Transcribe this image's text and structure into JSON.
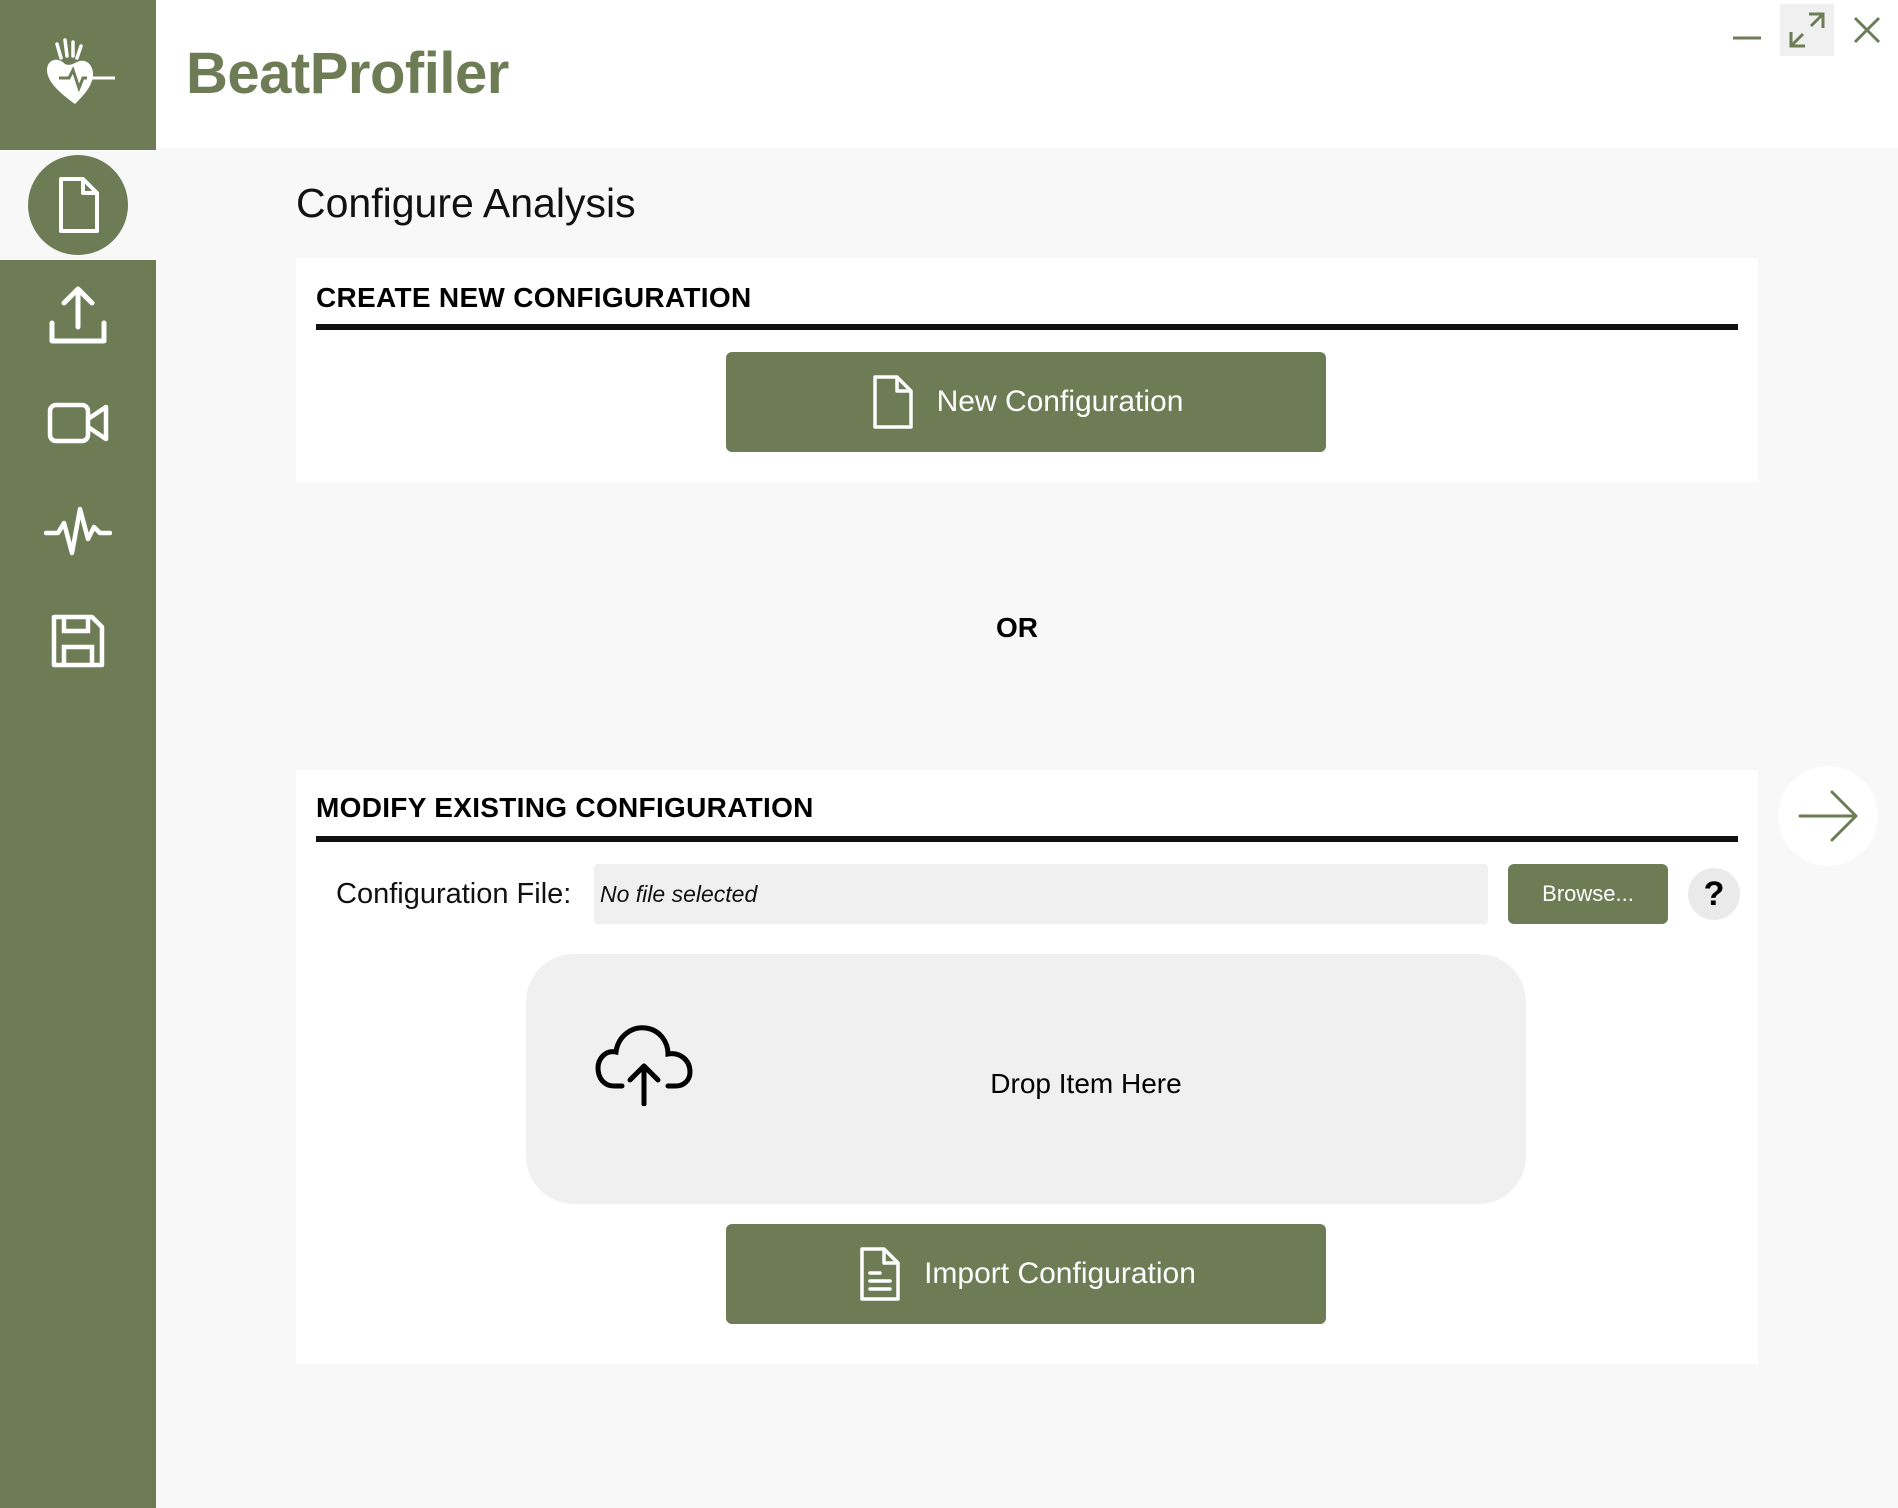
{
  "app": {
    "title": "BeatProfiler"
  },
  "window_controls": {
    "minimize": "minimize-icon",
    "maximize": "maximize-icon",
    "close": "close-icon"
  },
  "sidebar": {
    "items": [
      {
        "icon": "file-icon",
        "active": true
      },
      {
        "icon": "upload-icon",
        "active": false
      },
      {
        "icon": "video-icon",
        "active": false
      },
      {
        "icon": "waveform-icon",
        "active": false
      },
      {
        "icon": "save-icon",
        "active": false
      }
    ]
  },
  "main": {
    "page_title": "Configure Analysis",
    "create_section": {
      "title": "CREATE NEW CONFIGURATION",
      "button_label": "New Configuration"
    },
    "or_label": "OR",
    "modify_section": {
      "title": "MODIFY EXISTING CONFIGURATION",
      "file_label": "Configuration File:",
      "file_value": "No file selected",
      "browse_label": "Browse...",
      "help_label": "?",
      "drop_text": "Drop Item Here",
      "import_label": "Import Configuration"
    }
  },
  "colors": {
    "accent": "#6d7c55",
    "background": "#f8f8f8",
    "card": "#ffffff"
  }
}
